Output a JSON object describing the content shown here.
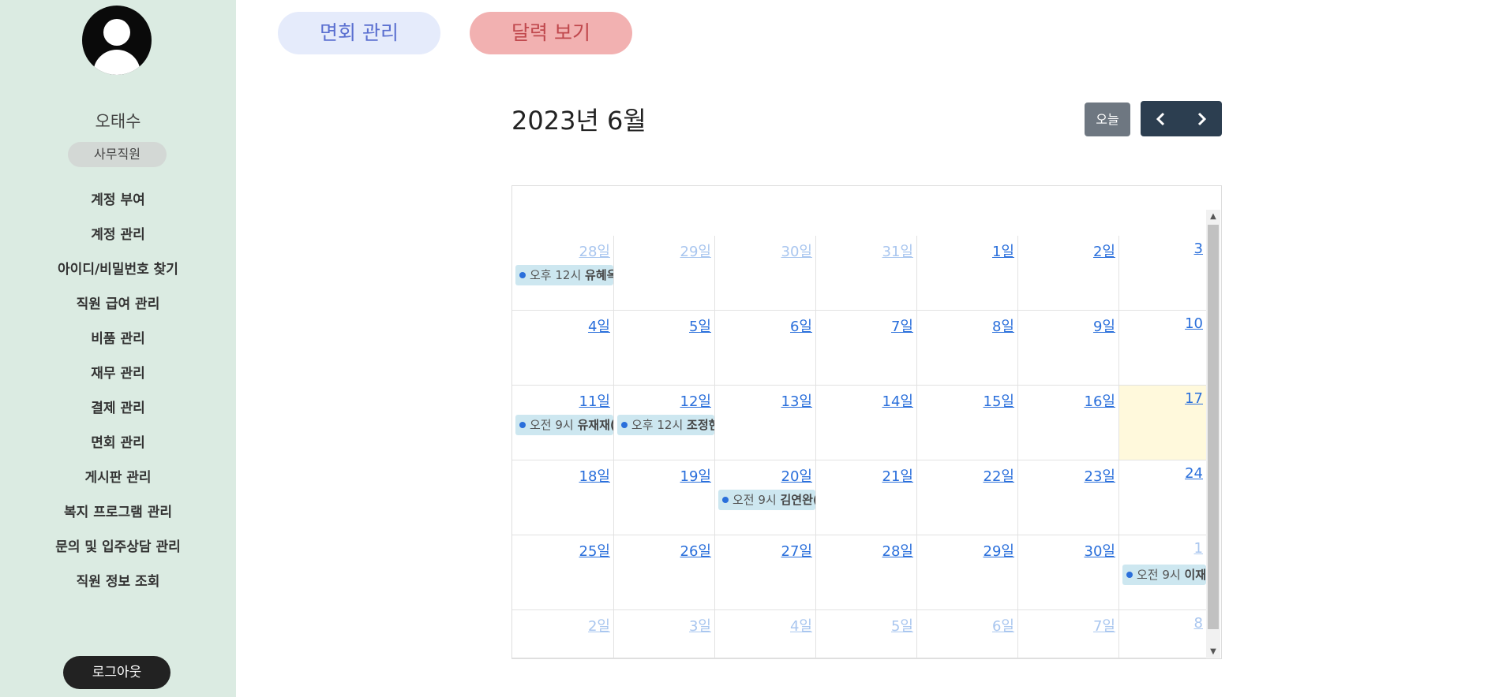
{
  "sidebar": {
    "user_name": "오태수",
    "role": "사무직원",
    "items": [
      {
        "label": "계정 부여"
      },
      {
        "label": "계정 관리"
      },
      {
        "label": "아이디/비밀번호 찾기"
      },
      {
        "label": "직원 급여 관리"
      },
      {
        "label": "비품 관리"
      },
      {
        "label": "재무 관리"
      },
      {
        "label": "결제 관리"
      },
      {
        "label": "면회 관리"
      },
      {
        "label": "게시판 관리"
      },
      {
        "label": "복지 프로그램 관리"
      },
      {
        "label": "문의 및 입주상담 관리"
      },
      {
        "label": "직원 정보 조회"
      }
    ],
    "logout_label": "로그아웃"
  },
  "tabs": {
    "visit_label": "면회 관리",
    "calendar_label": "달력 보기"
  },
  "calendar": {
    "title": "2023년 6월",
    "today_label": "오늘",
    "prev_icon": "chevron-left-icon",
    "next_icon": "chevron-right-icon",
    "weeks": [
      [
        {
          "label": "28일",
          "other": true,
          "event": {
            "time": "오후 12시",
            "name": "유혜옥"
          }
        },
        {
          "label": "29일",
          "other": true
        },
        {
          "label": "30일",
          "other": true
        },
        {
          "label": "31일",
          "other": true
        },
        {
          "label": "1일"
        },
        {
          "label": "2일"
        },
        {
          "label": "3"
        }
      ],
      [
        {
          "label": "4일"
        },
        {
          "label": "5일"
        },
        {
          "label": "6일"
        },
        {
          "label": "7일"
        },
        {
          "label": "8일"
        },
        {
          "label": "9일"
        },
        {
          "label": "10"
        }
      ],
      [
        {
          "label": "11일",
          "event": {
            "time": "오전 9시",
            "name": "유재재("
          }
        },
        {
          "label": "12일",
          "event": {
            "time": "오후 12시",
            "name": "조정현"
          }
        },
        {
          "label": "13일"
        },
        {
          "label": "14일"
        },
        {
          "label": "15일"
        },
        {
          "label": "16일"
        },
        {
          "label": "17",
          "today": true
        }
      ],
      [
        {
          "label": "18일"
        },
        {
          "label": "19일"
        },
        {
          "label": "20일",
          "event": {
            "time": "오전 9시",
            "name": "김연완("
          }
        },
        {
          "label": "21일"
        },
        {
          "label": "22일"
        },
        {
          "label": "23일"
        },
        {
          "label": "24"
        }
      ],
      [
        {
          "label": "25일"
        },
        {
          "label": "26일"
        },
        {
          "label": "27일"
        },
        {
          "label": "28일"
        },
        {
          "label": "29일"
        },
        {
          "label": "30일"
        },
        {
          "label": "1",
          "other": true,
          "event": {
            "time": "오전 9시",
            "name": "이재"
          }
        }
      ],
      [
        {
          "label": "2일",
          "other": true
        },
        {
          "label": "3일",
          "other": true
        },
        {
          "label": "4일",
          "other": true
        },
        {
          "label": "5일",
          "other": true
        },
        {
          "label": "6일",
          "other": true
        },
        {
          "label": "7일",
          "other": true
        },
        {
          "label": "8",
          "other": true
        }
      ]
    ]
  },
  "colors": {
    "sidebar_bg": "#dbebe2",
    "accent_blue": "#2a6fdb",
    "today_bg": "#fff9dc",
    "event_bg": "#cde7f0",
    "nav_dark": "#2c3e50"
  }
}
